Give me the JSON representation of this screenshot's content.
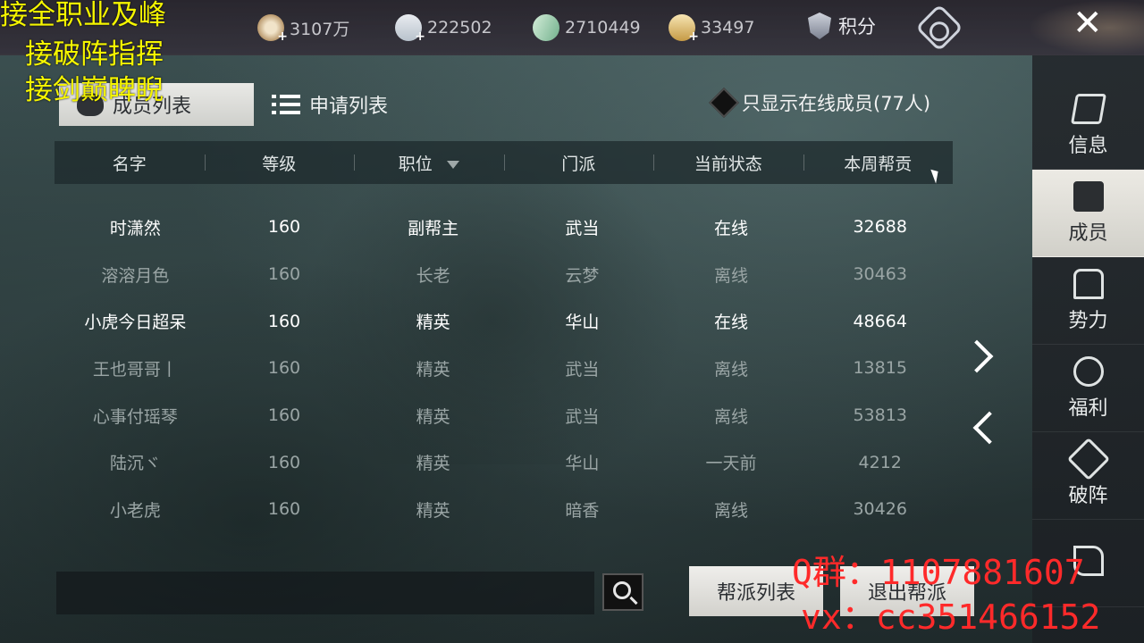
{
  "topbar": {
    "resources": [
      {
        "icon": "film-coin-icon",
        "value": "3107万"
      },
      {
        "icon": "silver-bowl-icon",
        "value": "222502"
      },
      {
        "icon": "jade-icon",
        "value": "2710449"
      },
      {
        "icon": "gold-bowl-icon",
        "value": "33497"
      }
    ],
    "score_label": "积分",
    "close_label": "✕"
  },
  "promo": {
    "line1": "接全职业及峰",
    "line2": "接破阵指挥",
    "line3": "接剑巅睥睨"
  },
  "watermark": {
    "line1": "Q群：1107881607",
    "line2": "vx：cc351466152"
  },
  "tabs": {
    "members": "成员列表",
    "applications": "申请列表"
  },
  "filter": {
    "label": "只显示在线成员(77人)"
  },
  "table": {
    "headers": [
      "名字",
      "等级",
      "职位",
      "门派",
      "当前状态",
      "本周帮贡"
    ],
    "rows": [
      {
        "name": "时潇然",
        "level": "160",
        "position": "副帮主",
        "sect": "武当",
        "status": "在线",
        "contribution": "32688",
        "online": true
      },
      {
        "name": "溶溶月色",
        "level": "160",
        "position": "长老",
        "sect": "云梦",
        "status": "离线",
        "contribution": "30463",
        "online": false
      },
      {
        "name": "小虎今日超呆",
        "level": "160",
        "position": "精英",
        "sect": "华山",
        "status": "在线",
        "contribution": "48664",
        "online": true
      },
      {
        "name": "王也哥哥丨",
        "level": "160",
        "position": "精英",
        "sect": "武当",
        "status": "离线",
        "contribution": "13815",
        "online": false
      },
      {
        "name": "心事付瑶琴",
        "level": "160",
        "position": "精英",
        "sect": "武当",
        "status": "离线",
        "contribution": "53813",
        "online": false
      },
      {
        "name": "陆沉ヾ",
        "level": "160",
        "position": "精英",
        "sect": "华山",
        "status": "一天前",
        "contribution": "4212",
        "online": false
      },
      {
        "name": "小老虎",
        "level": "160",
        "position": "精英",
        "sect": "暗香",
        "status": "离线",
        "contribution": "30426",
        "online": false
      }
    ]
  },
  "sidebar": {
    "items": [
      {
        "label": "信息",
        "icon": "info-flag-icon"
      },
      {
        "label": "成员",
        "icon": "members-banner-icon"
      },
      {
        "label": "势力",
        "icon": "power-scroll-icon"
      },
      {
        "label": "福利",
        "icon": "welfare-bag-icon"
      },
      {
        "label": "破阵",
        "icon": "crossed-swords-icon"
      },
      {
        "label": "",
        "icon": "hammer-icon"
      }
    ],
    "active_index": 1
  },
  "bottom": {
    "search_placeholder": "",
    "guild_list_label": "帮派列表",
    "leave_label": "退出帮派"
  }
}
